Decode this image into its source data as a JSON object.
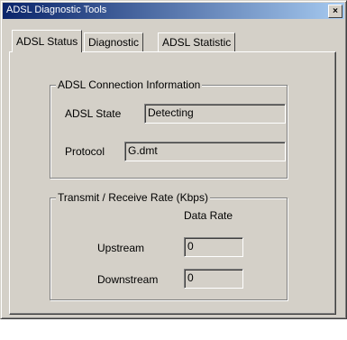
{
  "window": {
    "title": "ADSL Diagnostic Tools",
    "close_glyph": "×"
  },
  "tabs": [
    {
      "label": "ADSL Status",
      "active": true
    },
    {
      "label": "Diagnostic",
      "active": false
    },
    {
      "label": "ADSL Statistic",
      "active": false
    }
  ],
  "connection": {
    "legend": "ADSL Connection Information",
    "state_label": "ADSL State",
    "state_value": "Detecting",
    "protocol_label": "Protocol",
    "protocol_value": "G.dmt"
  },
  "rate": {
    "legend": "Transmit / Receive Rate  (Kbps)",
    "column_header": "Data Rate",
    "upstream_label": "Upstream",
    "upstream_value": "0",
    "downstream_label": "Downstream",
    "downstream_value": "0"
  }
}
